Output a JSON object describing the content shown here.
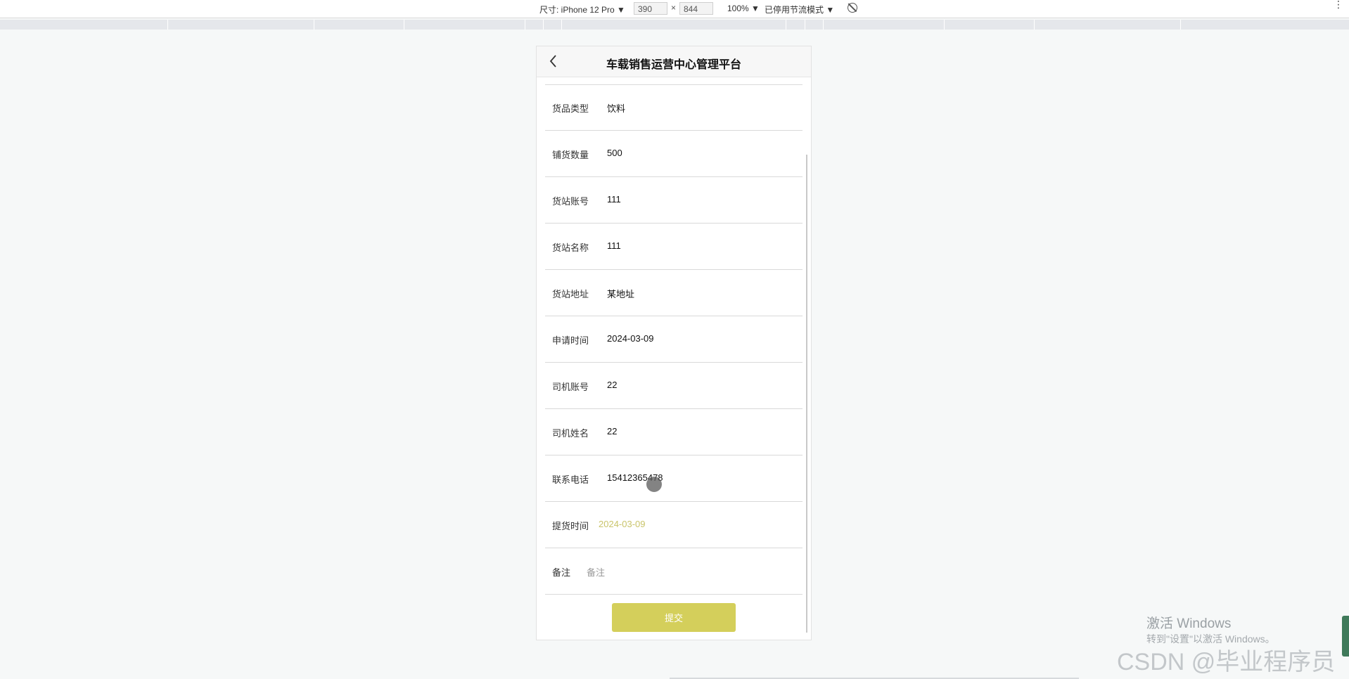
{
  "devtools": {
    "device_label": "尺寸: iPhone 12 Pro ▼",
    "width": "390",
    "times": "×",
    "height": "844",
    "zoom": "100% ▼",
    "throttle": "已停用节流模式 ▼",
    "kebab": "⋮"
  },
  "app": {
    "title": "车载销售运营中心管理平台",
    "back_icon": "chevron-left-icon"
  },
  "form": {
    "fields": [
      {
        "label": "货品类型",
        "value": "饮料"
      },
      {
        "label": "铺货数量",
        "value": "500"
      },
      {
        "label": "货站账号",
        "value": "111"
      },
      {
        "label": "货站名称",
        "value": "111"
      },
      {
        "label": "货站地址",
        "value": "某地址"
      },
      {
        "label": "申请时间",
        "value": "2024-03-09"
      },
      {
        "label": "司机账号",
        "value": "22"
      },
      {
        "label": "司机姓名",
        "value": "22"
      },
      {
        "label": "联系电话",
        "value": "15412365478"
      },
      {
        "label": "提货时间",
        "value": "2024-03-09"
      },
      {
        "label": "备注",
        "value": "备注"
      }
    ],
    "submit_label": "提交"
  },
  "overlay": {
    "windows_title": "激活 Windows",
    "windows_sub": "转到\"设置\"以激活 Windows。",
    "watermark": "CSDN @毕业程序员"
  },
  "colors": {
    "accent": "#d4cf5b",
    "picker_text": "#c9c46a"
  }
}
